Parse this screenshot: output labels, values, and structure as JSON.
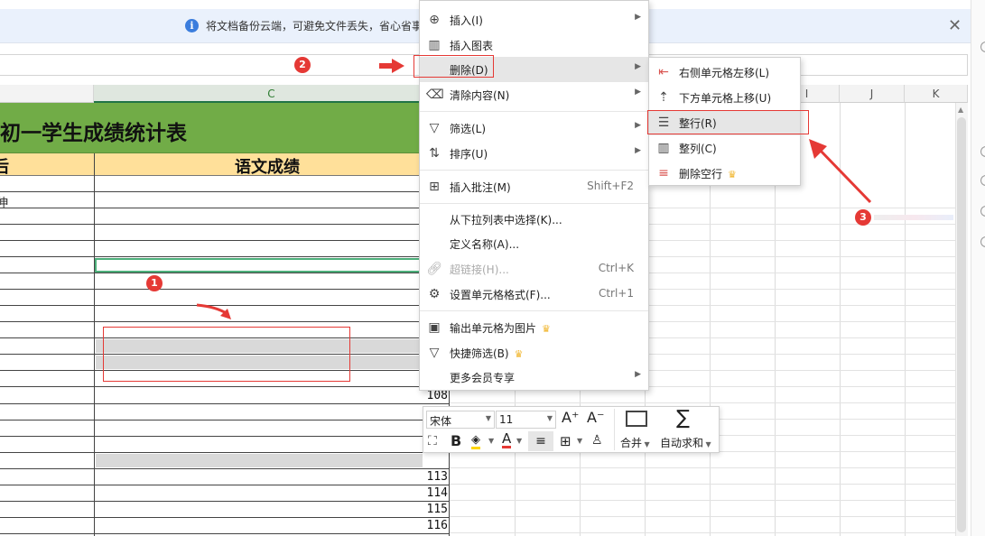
{
  "notice": {
    "text": "将文档备份云端，可避免文件丢失，省心省事",
    "close": "✕"
  },
  "columns": {
    "c": "C",
    "i": "I",
    "j": "J",
    "k": "K"
  },
  "sheet": {
    "title": "初一学生成绩统计表",
    "header_left_partial": "后",
    "header_chinese": "语文成绩",
    "left_partial_cell": "伸",
    "row_numbers": [
      "108",
      "113",
      "114",
      "115",
      "116"
    ]
  },
  "context_menu": {
    "items": [
      {
        "label": "插入(I)",
        "icon": "insert-icon"
      },
      {
        "label": "插入图表",
        "icon": "chart-icon"
      },
      {
        "label": "删除(D)",
        "icon": "delete-icon"
      },
      {
        "label": "清除内容(N)",
        "icon": "eraser-icon"
      },
      {
        "label": "筛选(L)",
        "icon": "filter-icon"
      },
      {
        "label": "排序(U)",
        "icon": "sort-icon"
      },
      {
        "label": "插入批注(M)",
        "shortcut": "Shift+F2",
        "icon": "comment-icon"
      },
      {
        "label": "从下拉列表中选择(K)..."
      },
      {
        "label": "定义名称(A)..."
      },
      {
        "label": "超链接(H)...",
        "shortcut": "Ctrl+K",
        "icon": "link-icon"
      },
      {
        "label": "设置单元格格式(F)...",
        "shortcut": "Ctrl+1",
        "icon": "format-cells-icon"
      },
      {
        "label": "输出单元格为图片",
        "icon": "image-icon"
      },
      {
        "label": "快捷筛选(B)",
        "icon": "quick-filter-icon"
      },
      {
        "label": "更多会员专享"
      }
    ]
  },
  "submenu": {
    "items": [
      {
        "label": "右侧单元格左移(L)"
      },
      {
        "label": "下方单元格上移(U)"
      },
      {
        "label": "整行(R)"
      },
      {
        "label": "整列(C)"
      },
      {
        "label": "删除空行"
      }
    ]
  },
  "mini_toolbar": {
    "font": "宋体",
    "size": "11",
    "grow": "A⁺",
    "shrink": "A⁻",
    "bold": "B",
    "font_color": "A",
    "merge": "合并",
    "autosum": "自动求和",
    "sigma": "∑"
  },
  "annotations": [
    "1",
    "2",
    "3"
  ],
  "colors": {
    "title_green": "#71ac47",
    "header_yellow": "#ffe09a",
    "annotation_red": "#e53935"
  }
}
